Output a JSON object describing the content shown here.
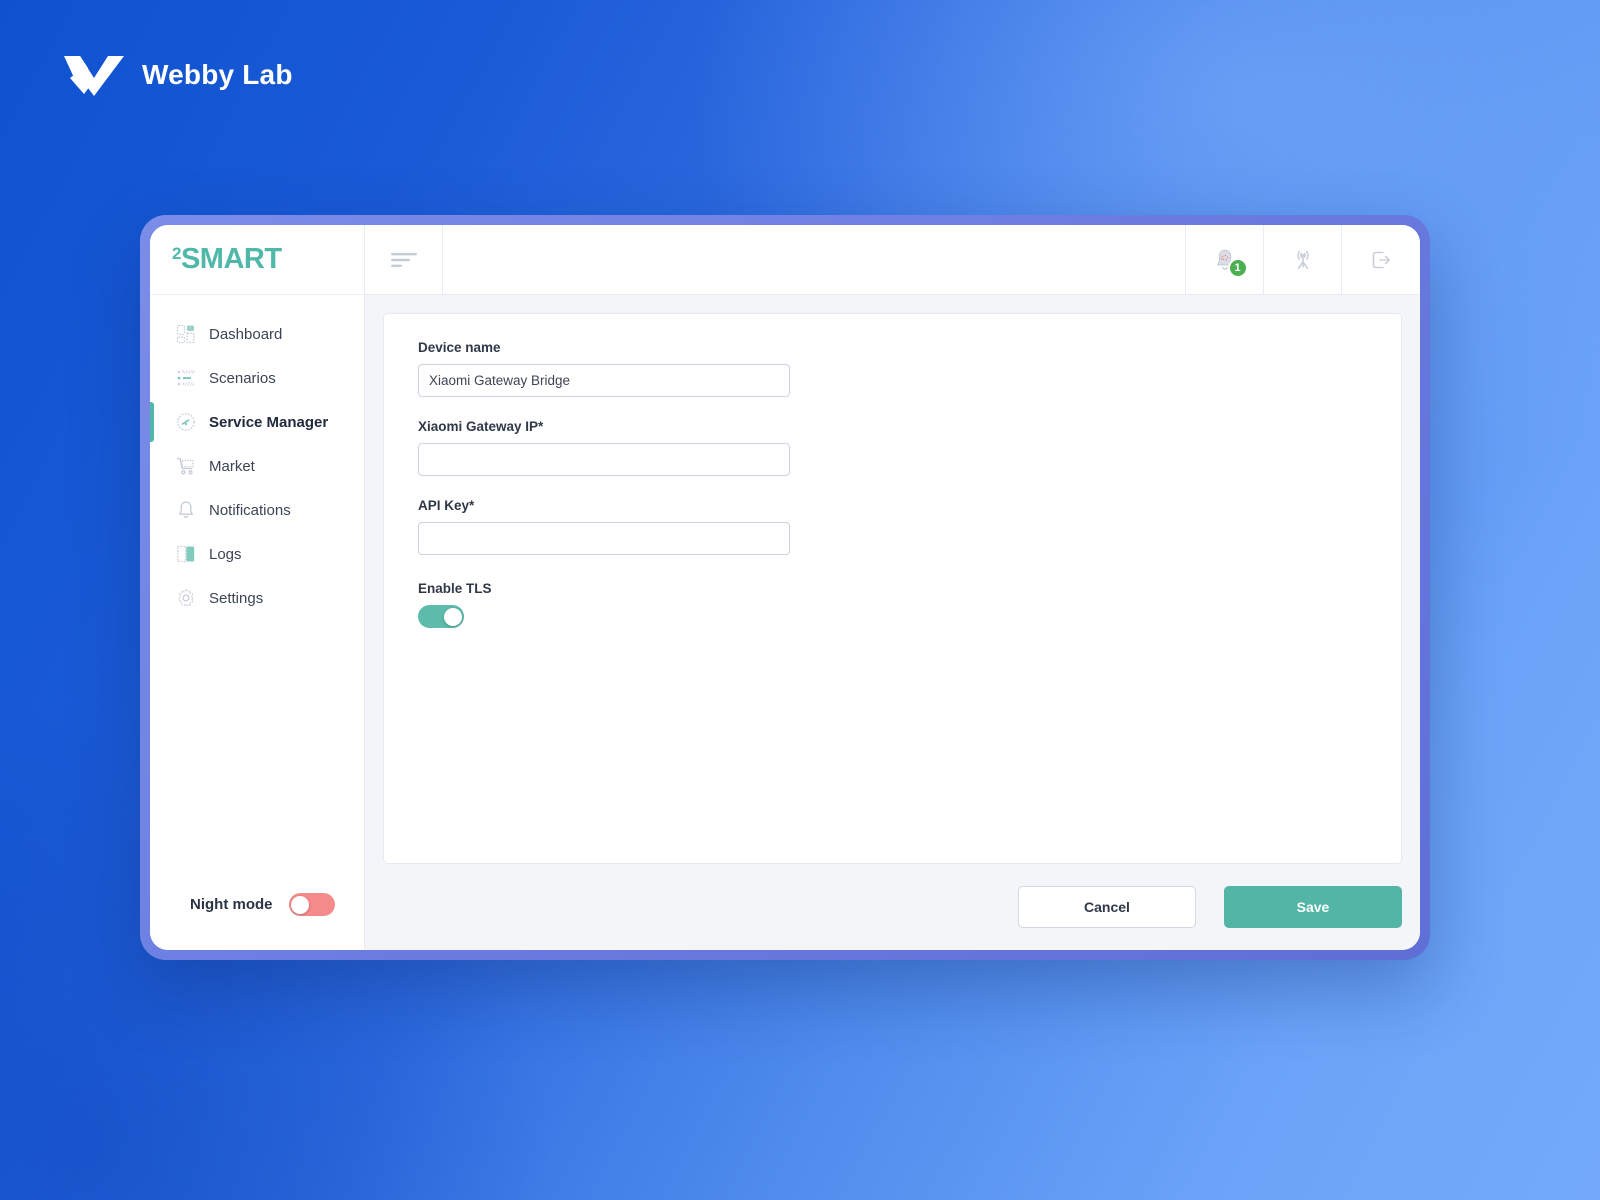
{
  "brand": {
    "name": "Webby Lab",
    "mark_icon": "webbylab-chevron-logo"
  },
  "app": {
    "logo_superscript": "2",
    "logo_text": "SMART"
  },
  "sidebar": {
    "items": [
      {
        "label": "Dashboard",
        "icon": "dashboard-icon",
        "active": false
      },
      {
        "label": "Scenarios",
        "icon": "scenarios-list-icon",
        "active": false
      },
      {
        "label": "Service Manager",
        "icon": "gauge-icon",
        "active": true
      },
      {
        "label": "Market",
        "icon": "shopping-cart-icon",
        "active": false
      },
      {
        "label": "Notifications",
        "icon": "bell-icon",
        "active": false
      },
      {
        "label": "Logs",
        "icon": "book-icon",
        "active": false
      },
      {
        "label": "Settings",
        "icon": "gear-icon",
        "active": false
      }
    ],
    "night_mode": {
      "label": "Night mode",
      "state": "off"
    }
  },
  "topbar": {
    "menu_icon": "hamburger-menu-icon",
    "notifications": {
      "icon": "bell-icon",
      "badge_count": "1"
    },
    "broadcast": {
      "icon": "antenna-tower-icon"
    },
    "logout": {
      "icon": "logout-icon"
    }
  },
  "form": {
    "fields": [
      {
        "label": "Device name",
        "value": "Xiaomi Gateway Bridge",
        "placeholder": ""
      },
      {
        "label": "Xiaomi Gateway IP*",
        "value": "",
        "placeholder": ""
      },
      {
        "label": "API Key*",
        "value": "",
        "placeholder": ""
      }
    ],
    "tls": {
      "label": "Enable TLS",
      "state": "on"
    }
  },
  "actions": {
    "cancel_label": "Cancel",
    "save_label": "Save"
  },
  "colors": {
    "accent_teal": "#52b5a6",
    "badge_green": "#4caf50",
    "toggle_off_red": "#f58a8a",
    "frame_purple": "#6a7ce0",
    "background_blue": "#1a5ad6"
  }
}
